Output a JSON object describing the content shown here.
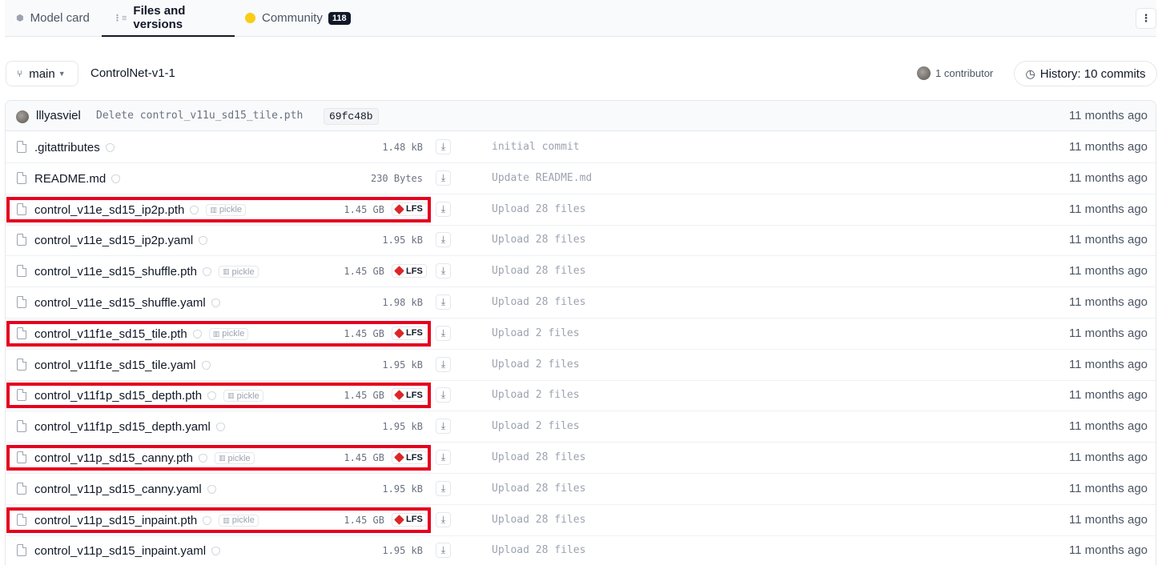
{
  "tabs": {
    "model_card": "Model card",
    "files": "Files and versions",
    "community": "Community",
    "community_count": "118"
  },
  "more_glyph": "⋮",
  "branch": {
    "name": "main",
    "path": "ControlNet-v1-1"
  },
  "contributors": "1 contributor",
  "history": "History: 10 commits",
  "last_commit": {
    "author": "lllyasviel",
    "message": "Delete control_v11u_sd15_tile.pth",
    "hash": "69fc48b",
    "when": "11 months ago"
  },
  "labels": {
    "pickle": "pickle",
    "lfs": "LFS"
  },
  "files": [
    {
      "name": ".gitattributes",
      "size": "1.48 kB",
      "lfs": false,
      "pickle": false,
      "commit": "initial commit",
      "when": "11 months ago",
      "highlighted": false
    },
    {
      "name": "README.md",
      "size": "230 Bytes",
      "lfs": false,
      "pickle": false,
      "commit": "Update README.md",
      "when": "11 months ago",
      "highlighted": false
    },
    {
      "name": "control_v11e_sd15_ip2p.pth",
      "size": "1.45 GB",
      "lfs": true,
      "pickle": true,
      "commit": "Upload 28 files",
      "when": "11 months ago",
      "highlighted": true
    },
    {
      "name": "control_v11e_sd15_ip2p.yaml",
      "size": "1.95 kB",
      "lfs": false,
      "pickle": false,
      "commit": "Upload 28 files",
      "when": "11 months ago",
      "highlighted": false
    },
    {
      "name": "control_v11e_sd15_shuffle.pth",
      "size": "1.45 GB",
      "lfs": true,
      "pickle": true,
      "commit": "Upload 28 files",
      "when": "11 months ago",
      "highlighted": false
    },
    {
      "name": "control_v11e_sd15_shuffle.yaml",
      "size": "1.98 kB",
      "lfs": false,
      "pickle": false,
      "commit": "Upload 28 files",
      "when": "11 months ago",
      "highlighted": false
    },
    {
      "name": "control_v11f1e_sd15_tile.pth",
      "size": "1.45 GB",
      "lfs": true,
      "pickle": true,
      "commit": "Upload 2 files",
      "when": "11 months ago",
      "highlighted": true
    },
    {
      "name": "control_v11f1e_sd15_tile.yaml",
      "size": "1.95 kB",
      "lfs": false,
      "pickle": false,
      "commit": "Upload 2 files",
      "when": "11 months ago",
      "highlighted": false
    },
    {
      "name": "control_v11f1p_sd15_depth.pth",
      "size": "1.45 GB",
      "lfs": true,
      "pickle": true,
      "commit": "Upload 2 files",
      "when": "11 months ago",
      "highlighted": true
    },
    {
      "name": "control_v11f1p_sd15_depth.yaml",
      "size": "1.95 kB",
      "lfs": false,
      "pickle": false,
      "commit": "Upload 2 files",
      "when": "11 months ago",
      "highlighted": false
    },
    {
      "name": "control_v11p_sd15_canny.pth",
      "size": "1.45 GB",
      "lfs": true,
      "pickle": true,
      "commit": "Upload 28 files",
      "when": "11 months ago",
      "highlighted": true
    },
    {
      "name": "control_v11p_sd15_canny.yaml",
      "size": "1.95 kB",
      "lfs": false,
      "pickle": false,
      "commit": "Upload 28 files",
      "when": "11 months ago",
      "highlighted": false
    },
    {
      "name": "control_v11p_sd15_inpaint.pth",
      "size": "1.45 GB",
      "lfs": true,
      "pickle": true,
      "commit": "Upload 28 files",
      "when": "11 months ago",
      "highlighted": true
    },
    {
      "name": "control_v11p_sd15_inpaint.yaml",
      "size": "1.95 kB",
      "lfs": false,
      "pickle": false,
      "commit": "Upload 28 files",
      "when": "11 months ago",
      "highlighted": false
    }
  ]
}
